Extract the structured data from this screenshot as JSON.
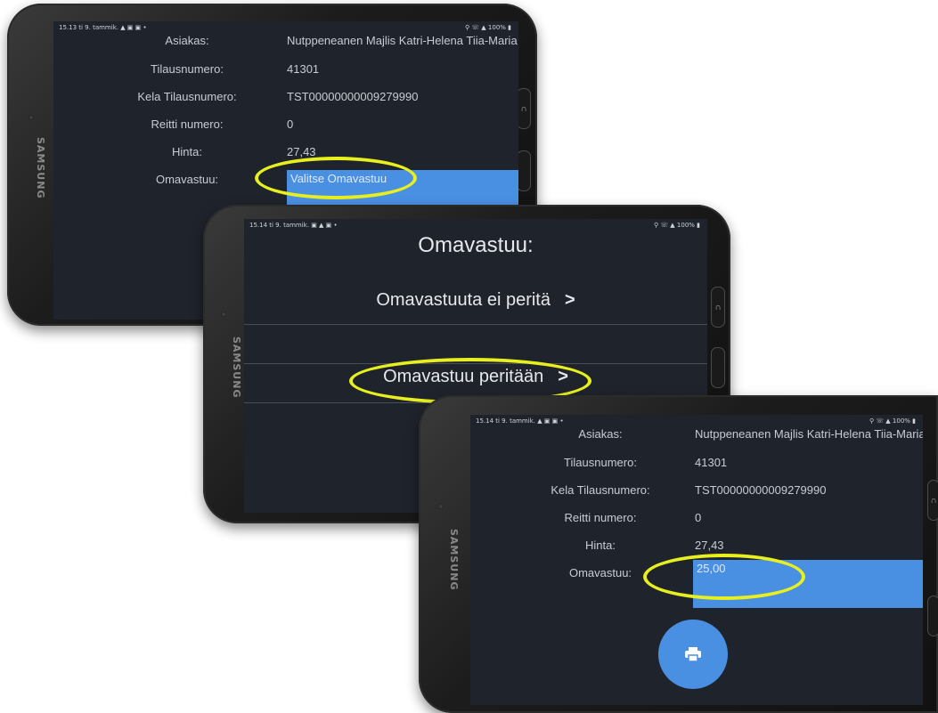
{
  "screen1": {
    "status_left": "15.13  ti 9. tammik.  ▲ ▣ ▣ •",
    "status_right": "⚲ ☏ ▲ 100% ▮",
    "rows": [
      {
        "label": "Asiakas:",
        "value": "Nutppeneanen Majlis Katri-Helena Tiia-Maria"
      },
      {
        "label": "Tilausnumero:",
        "value": "41301"
      },
      {
        "label": "Kela Tilausnumero:",
        "value": "TST00000000009279990"
      },
      {
        "label": "Reitti numero:",
        "value": "0"
      },
      {
        "label": "Hinta:",
        "value": "27,43"
      },
      {
        "label": "Omavastuu:",
        "value": "Valitse Omavastuu"
      }
    ]
  },
  "screen2": {
    "status_left": "15.14  ti 9. tammik.  ▣ ▲ ▣ •",
    "status_right": "⚲ ☏ ▲ 100% ▮",
    "title": "Omavastuu:",
    "options": [
      {
        "label": "Omavastuuta ei peritä",
        "chevron": ">"
      },
      {
        "label": "Omavastuu peritään",
        "chevron": ">"
      }
    ]
  },
  "screen3": {
    "status_left": "15.14  ti 9. tammik.  ▲ ▣ ▣ •",
    "status_right": "⚲ ☏ ▲ 100% ▮",
    "rows": [
      {
        "label": "Asiakas:",
        "value": "Nutppeneanen Majlis Katri-Helena Tiia-Maria"
      },
      {
        "label": "Tilausnumero:",
        "value": "41301"
      },
      {
        "label": "Kela Tilausnumero:",
        "value": "TST00000000009279990"
      },
      {
        "label": "Reitti numero:",
        "value": "0"
      },
      {
        "label": "Hinta:",
        "value": "27,43"
      },
      {
        "label": "Omavastuu:",
        "value": "25,00"
      }
    ],
    "fab_icon": "print-icon"
  },
  "device": {
    "brand": "SAMSUNG"
  },
  "colors": {
    "screen_bg": "#1f232b",
    "accent": "#4a90e2",
    "highlight": "#e8ef1f"
  }
}
